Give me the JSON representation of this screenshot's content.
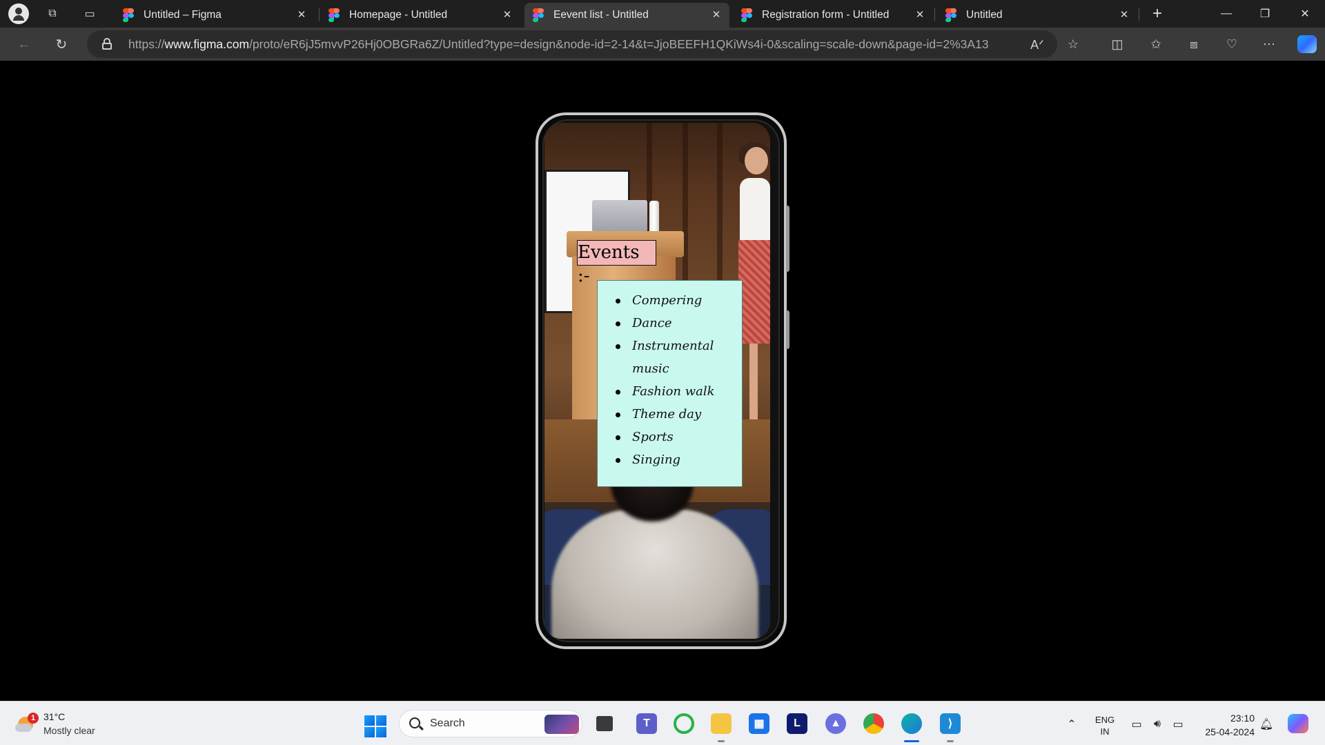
{
  "browser": {
    "tabs": [
      {
        "label": "Untitled – Figma",
        "active": false
      },
      {
        "label": "Homepage - Untitled",
        "active": false
      },
      {
        "label": "Eevent list - Untitled",
        "active": true
      },
      {
        "label": "Registration form - Untitled",
        "active": false
      },
      {
        "label": "Untitled",
        "active": false
      }
    ],
    "url_prefix": "https://",
    "url_host": "www.figma.com",
    "url_path": "/proto/eR6jJ5mvvP26Hj0OBGRa6Z/Untitled?type=design&node-id=2-14&t=JjoBEEFH1QKiWs4i-0&scaling=scale-down&page-id=2%3A13",
    "accent_color": "#0a66d6"
  },
  "prototype": {
    "events_title": "Events :-",
    "events": [
      "Compering",
      "Dance",
      "Instrumental music",
      "Fashion walk",
      "Theme day",
      "Sports",
      "Singing"
    ],
    "title_bg": "#f3b7b7",
    "list_bg": "#c9f8ee"
  },
  "taskbar": {
    "weather_badge": "1",
    "temperature": "31°C",
    "condition": "Mostly clear",
    "search_placeholder": "Search",
    "apps": [
      "task-view-icon",
      "teams-icon",
      "copilot-ring-icon",
      "file-explorer-icon",
      "store-icon",
      "l-app-icon",
      "arc-icon",
      "chrome-icon",
      "edge-icon",
      "vscode-icon"
    ],
    "lang_top": "ENG",
    "lang_bottom": "IN",
    "time": "23:10",
    "date": "25-04-2024"
  }
}
